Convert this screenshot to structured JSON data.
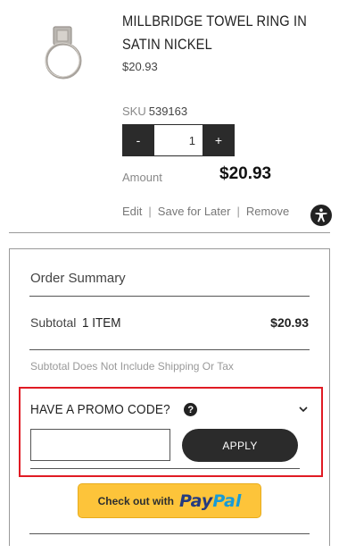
{
  "product": {
    "title": "MILLBRIDGE TOWEL RING IN SATIN NICKEL",
    "price": "$20.93",
    "sku_label": "SKU",
    "sku_value": "539163",
    "quantity": "1",
    "decrement_label": "-",
    "increment_label": "+",
    "amount_label": "Amount",
    "amount_value": "$20.93",
    "image_icon": "towel-ring-image"
  },
  "actions": {
    "edit": "Edit",
    "save_for_later": "Save for Later",
    "remove": "Remove",
    "separator": "|"
  },
  "order_summary": {
    "title": "Order Summary",
    "subtotal_label": "Subtotal",
    "subtotal_items": "1 ITEM",
    "subtotal_value": "$20.93",
    "note": "Subtotal Does Not Include Shipping Or Tax",
    "promo": {
      "title": "HAVE A PROMO CODE?",
      "input_value": "",
      "apply_label": "APPLY",
      "highlight_color": "#e01b24"
    },
    "paypal": {
      "prefix": "Check out with",
      "pay": "Pay",
      "pal": "Pal"
    }
  },
  "colors": {
    "button_dark": "#2b2b2b",
    "paypal_yellow": "#fdc43a",
    "paypal_navy": "#253b80",
    "paypal_blue": "#179bd7"
  },
  "icons": [
    "accessibility-icon",
    "help-icon",
    "chevron-down-icon"
  ]
}
